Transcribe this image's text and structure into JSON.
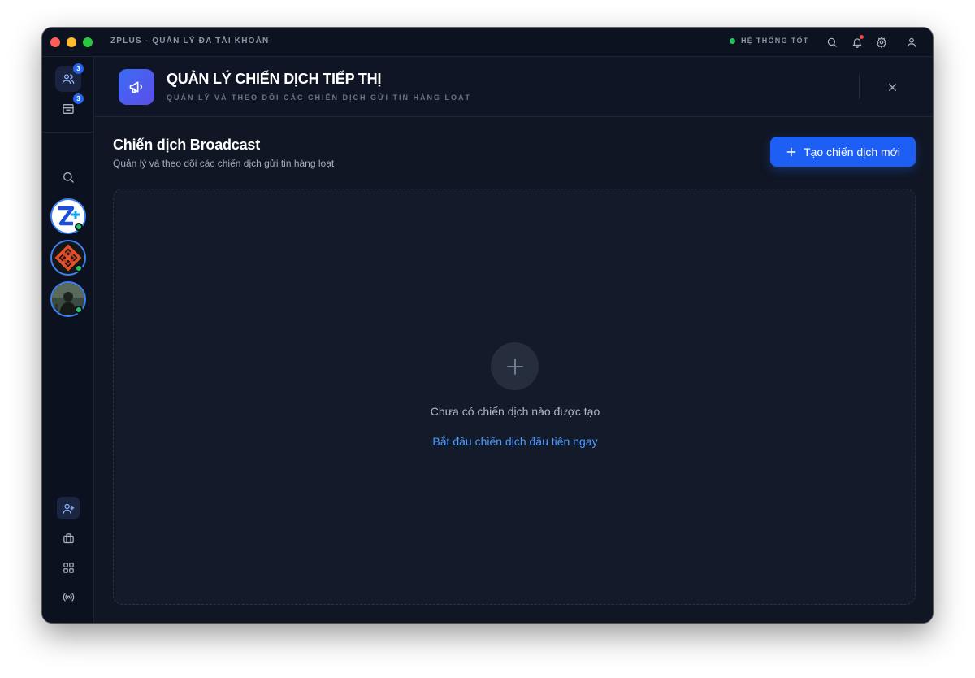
{
  "titlebar": {
    "app_title": "ZPLUS - QUẢN LÝ ĐA TÀI KHOẢN",
    "status_text": "HỆ THỐNG TỐT",
    "status_color": "#22c55e"
  },
  "sidebar": {
    "top_items": [
      {
        "icon": "users-icon",
        "badge": "3"
      },
      {
        "icon": "inbox-icon",
        "badge": "3"
      }
    ],
    "search_icon": "search-icon",
    "accounts": [
      {
        "name": "zplus-account",
        "online": true
      },
      {
        "name": "red-logo-account",
        "online": true
      },
      {
        "name": "photo-account",
        "online": true
      }
    ],
    "bottom_items": [
      {
        "icon": "user-plus-icon",
        "active": true
      },
      {
        "icon": "briefcase-icon",
        "active": false
      },
      {
        "icon": "grid-icon",
        "active": false
      },
      {
        "icon": "broadcast-icon",
        "active": false
      },
      {
        "icon": "panel-toggle-icon",
        "active": false
      }
    ]
  },
  "header": {
    "title": "QUẢN LÝ CHIẾN DỊCH TIẾP THỊ",
    "subtitle": "QUẢN LÝ VÀ THEO DÕI CÁC CHIẾN DỊCH GỬI TIN HÀNG LOẠT",
    "icon": "megaphone-icon"
  },
  "section": {
    "title": "Chiến dịch Broadcast",
    "subtitle": "Quản lý và theo dõi các chiến dịch gửi tin hàng loạt",
    "create_button": "Tạo chiến dịch mới"
  },
  "empty_state": {
    "message": "Chưa có chiến dịch nào được tạo",
    "action_link": "Bắt đầu chiến dịch đầu tiên ngay"
  },
  "colors": {
    "accent": "#1d5ef5",
    "link": "#4e9bff",
    "background": "#101624"
  }
}
